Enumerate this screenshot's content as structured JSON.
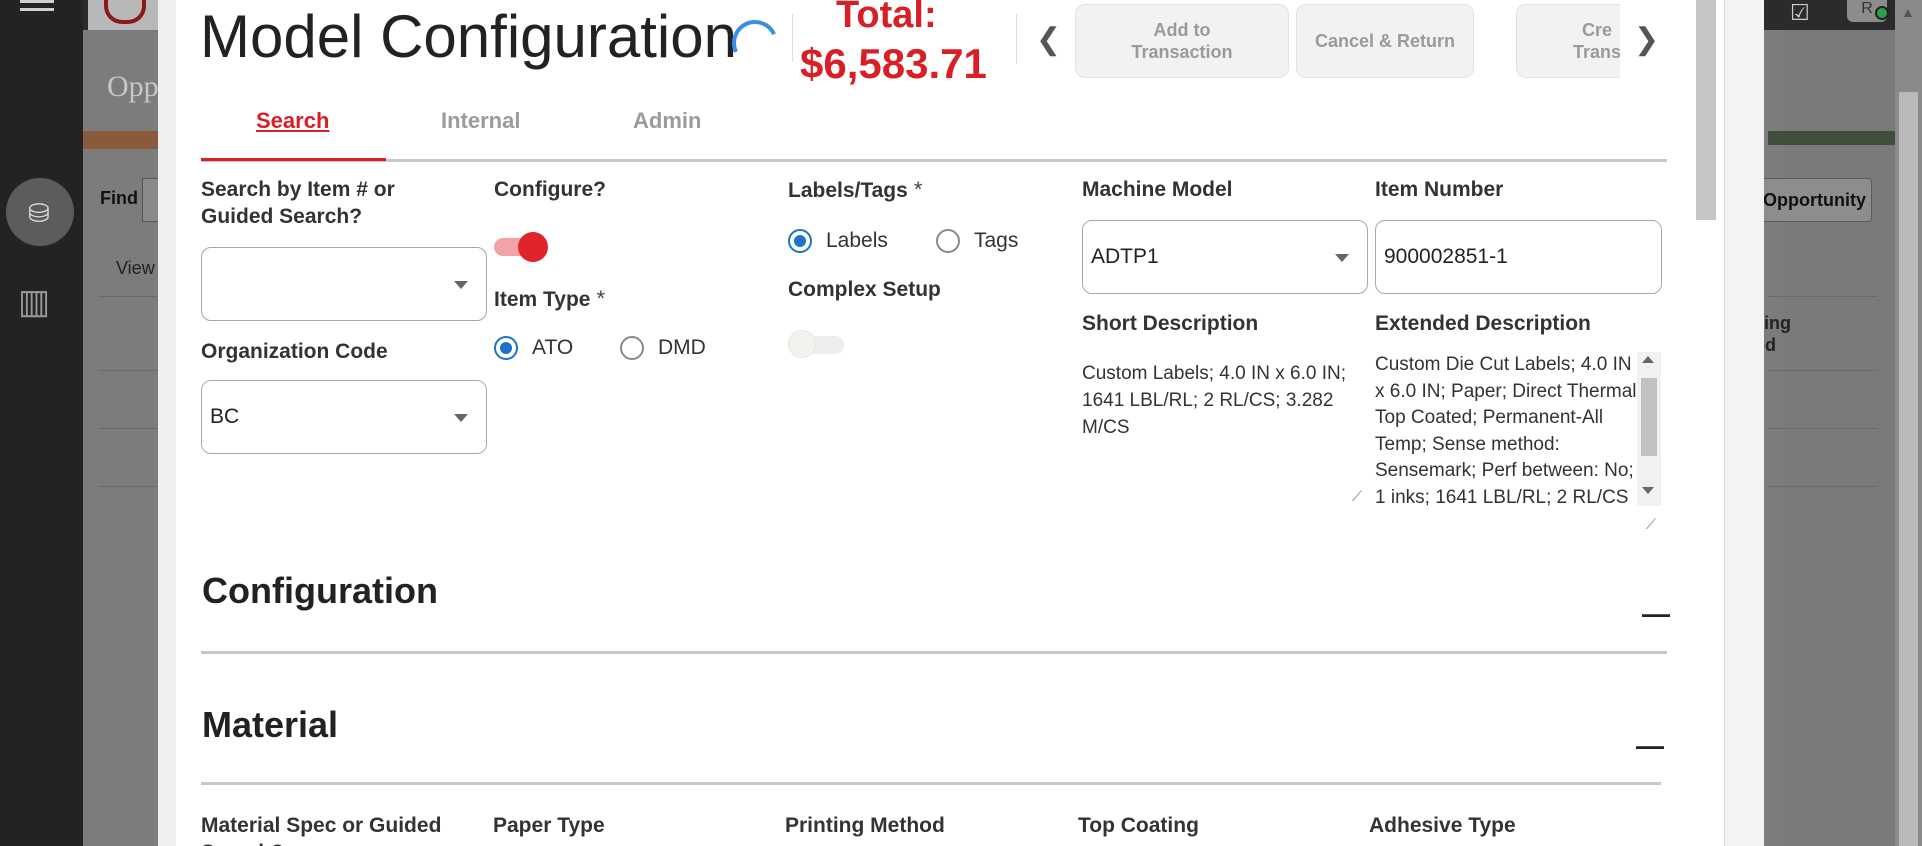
{
  "background": {
    "page_title": "Opp",
    "find_label": "Find",
    "view_label": "View",
    "opportunity_button": "Opportunity",
    "column_label": "cing\nod",
    "user_initials": "R"
  },
  "header": {
    "title": "Model Configuration",
    "total_label": "Total:",
    "total_value": "$6,583.71",
    "buttons": {
      "add_to_transaction": "Add to\nTransaction",
      "cancel_return": "Cancel & Return",
      "create_transaction": "Cre\nTrans"
    }
  },
  "tabs": [
    {
      "label": "Search",
      "active": true
    },
    {
      "label": "Internal",
      "active": false
    },
    {
      "label": "Admin",
      "active": false
    }
  ],
  "form": {
    "search_by": {
      "label": "Search by Item # or Guided Search?",
      "value": ""
    },
    "organization_code": {
      "label": "Organization Code",
      "value": "BC"
    },
    "configure": {
      "label": "Configure?",
      "on": true
    },
    "item_type": {
      "label": "Item Type",
      "required": "*",
      "options": [
        "ATO",
        "DMD"
      ],
      "selected": "ATO"
    },
    "labels_tags": {
      "label": "Labels/Tags",
      "required": "*",
      "options": [
        "Labels",
        "Tags"
      ],
      "selected": "Labels"
    },
    "complex_setup": {
      "label": "Complex Setup",
      "on": false
    },
    "machine_model": {
      "label": "Machine Model",
      "value": "ADTP1"
    },
    "item_number": {
      "label": "Item Number",
      "value": "900002851-1"
    },
    "short_description": {
      "label": "Short Description",
      "value": "Custom Labels; 4.0 IN x 6.0 IN; 1641 LBL/RL; 2 RL/CS; 3.282 M/CS"
    },
    "extended_description": {
      "label": "Extended Description",
      "value": "Custom Die Cut Labels; 4.0 IN x 6.0 IN; Paper; Direct Thermal; Top Coated; Permanent-All Temp; Sense method: Sensemark; Perf between: No; 1 inks; 1641 LBL/RL; 2 RL/CS"
    }
  },
  "sections": {
    "configuration": {
      "title": "Configuration",
      "collapse": "—"
    },
    "material": {
      "title": "Material",
      "collapse": "—"
    }
  },
  "material_columns": [
    "Material Spec or Guided Search?",
    "Paper Type",
    "Printing Method",
    "Top Coating",
    "Adhesive Type"
  ],
  "colors": {
    "accent": "#d81f26",
    "radio": "#1b73c7",
    "toggle_on": "#e0242b"
  },
  "icons": [
    "hamburger-icon",
    "chevron-left-icon",
    "chevron-right-icon",
    "caret-down-icon",
    "loading-spinner-icon",
    "minus-icon"
  ]
}
